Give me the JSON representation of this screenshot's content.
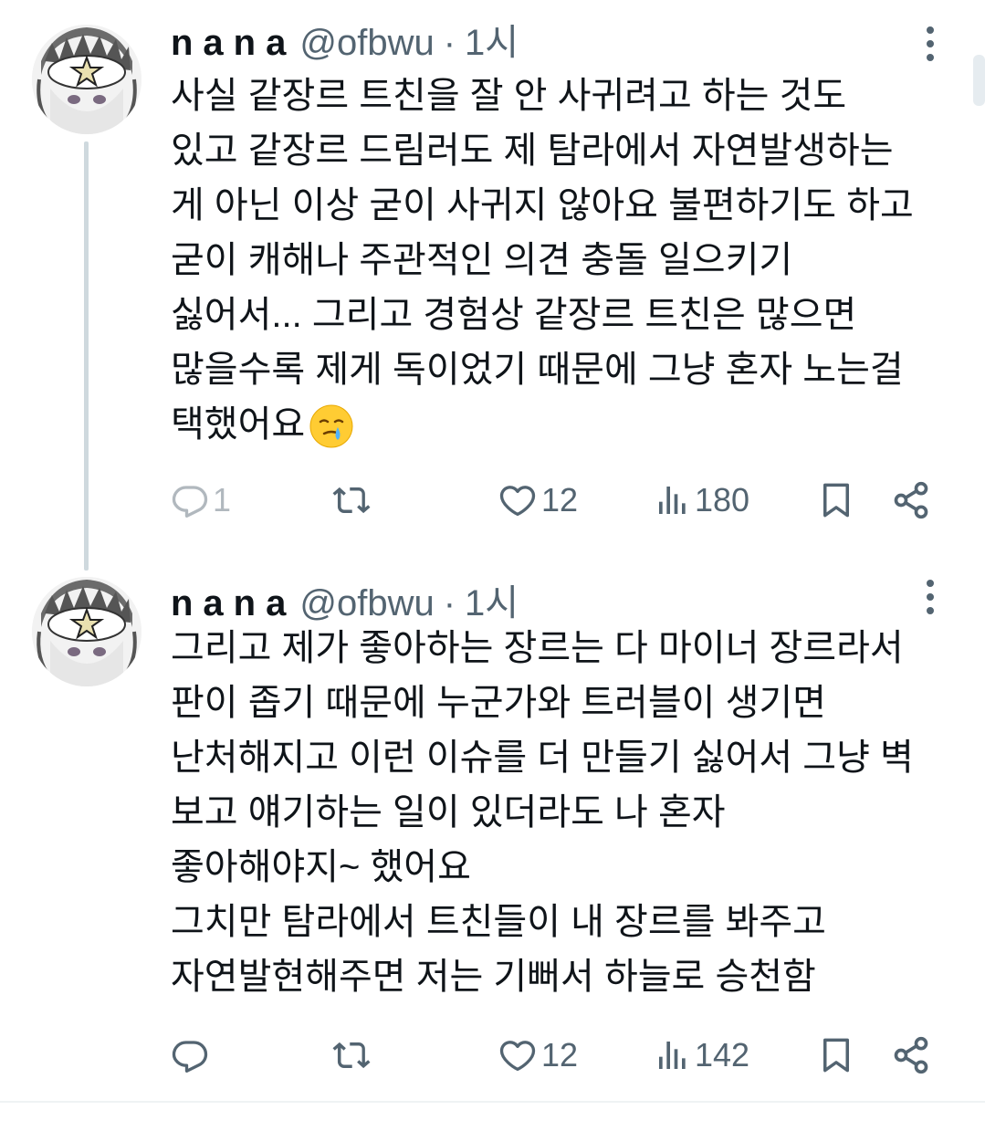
{
  "tweets": [
    {
      "display_name": "nana",
      "handle": "@ofbwu",
      "separator": "·",
      "time": "1시",
      "lines": [
        "사실 같장르 트친을 잘 안 사귀려고 하는 것도",
        "있고 같장르 드림러도 제 탐라에서 자연발생하는",
        "게 아닌 이상 굳이 사귀지 않아요 불편하기도 하고",
        "굳이 캐해나 주관적인 의견 충돌 일으키기",
        "싫어서... 그리고 경험상 같장르 트친은 많으면",
        "많을수록 제게 독이었기 때문에 그냥 혼자 노는걸",
        "택했어요"
      ],
      "trailing_emoji": "face-holding-back-tears",
      "reply_count": "1",
      "retweet_count": "",
      "like_count": "12",
      "view_count": "180"
    },
    {
      "display_name": "nana",
      "handle": "@ofbwu",
      "separator": "·",
      "time": "1시",
      "lines": [
        "그리고 제가 좋아하는 장르는 다 마이너 장르라서",
        "판이 좁기 때문에 누군가와 트러블이 생기면",
        "난처해지고 이런 이슈를 더 만들기 싫어서 그냥 벽",
        "보고 얘기하는 일이 있더라도 나 혼자",
        "좋아해야지~ 했어요",
        "그치만 탐라에서 트친들이 내 장르를 봐주고",
        "자연발현해주면 저는 기뻐서 하늘로 승천함"
      ],
      "reply_count": "",
      "retweet_count": "",
      "like_count": "12",
      "view_count": "142"
    }
  ],
  "colors": {
    "text": "#0f1419",
    "secondary": "#536471",
    "thread_line": "#cfd9de",
    "divider": "#eff3f4"
  },
  "icons": [
    "avatar-image",
    "more-icon",
    "reply-icon",
    "retweet-icon",
    "like-icon",
    "views-icon",
    "bookmark-icon",
    "share-icon"
  ]
}
